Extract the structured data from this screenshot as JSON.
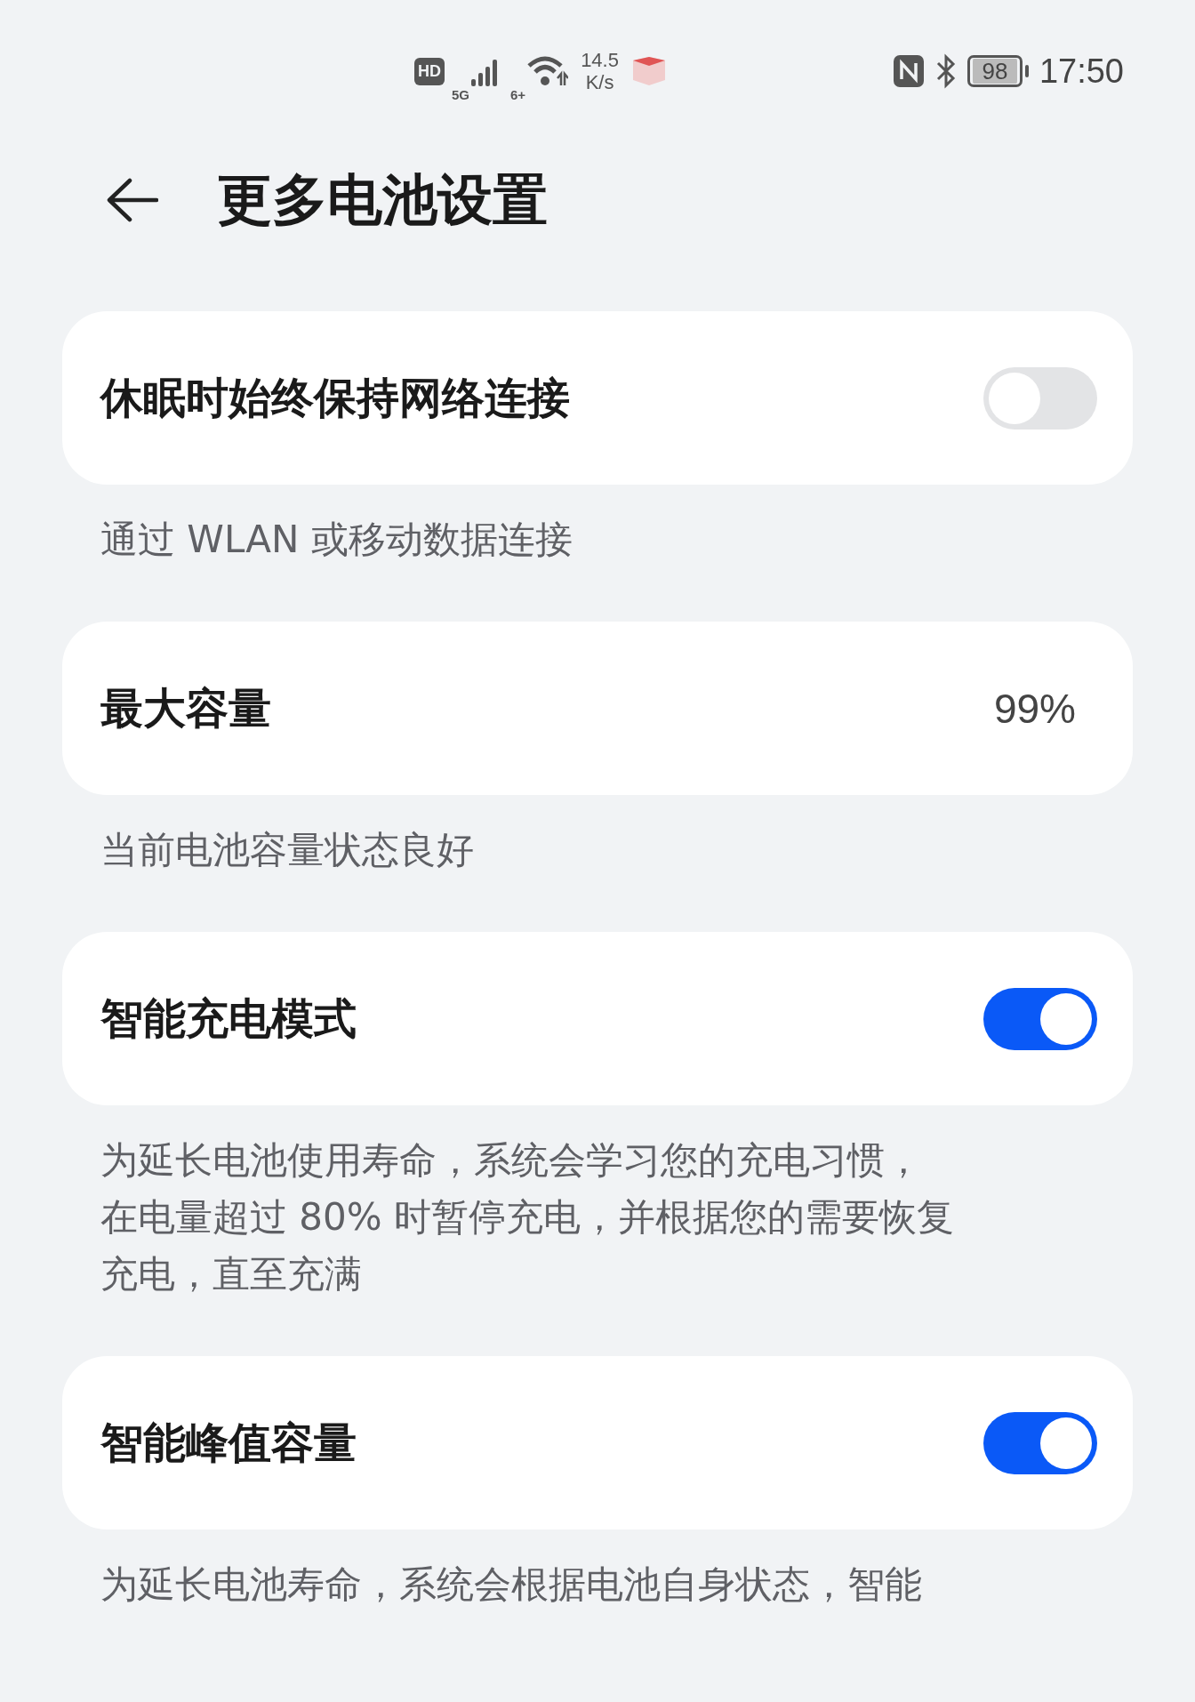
{
  "status_bar": {
    "hd": "HD",
    "mobile_network": "5G",
    "wifi_standard": "6+",
    "speed_value": "14.5",
    "speed_unit": "K/s",
    "battery": "98",
    "time": "17:50"
  },
  "header": {
    "title": "更多电池设置"
  },
  "items": [
    {
      "kind": "toggle",
      "label": "休眠时始终保持网络连接",
      "on": false,
      "description": [
        "通过 WLAN 或移动数据连接"
      ]
    },
    {
      "kind": "value",
      "label": "最大容量",
      "value": "99%",
      "description": [
        "当前电池容量状态良好"
      ]
    },
    {
      "kind": "toggle",
      "label": "智能充电模式",
      "on": true,
      "description": [
        "为延长电池使用寿命，系统会学习您的充电习惯，",
        "在电量超过 80% 时暂停充电，并根据您的需要恢复",
        "充电，直至充满"
      ]
    },
    {
      "kind": "toggle",
      "label": "智能峰值容量",
      "on": true,
      "description": [
        "为延长电池寿命，系统会根据电池自身状态，智能"
      ]
    }
  ]
}
